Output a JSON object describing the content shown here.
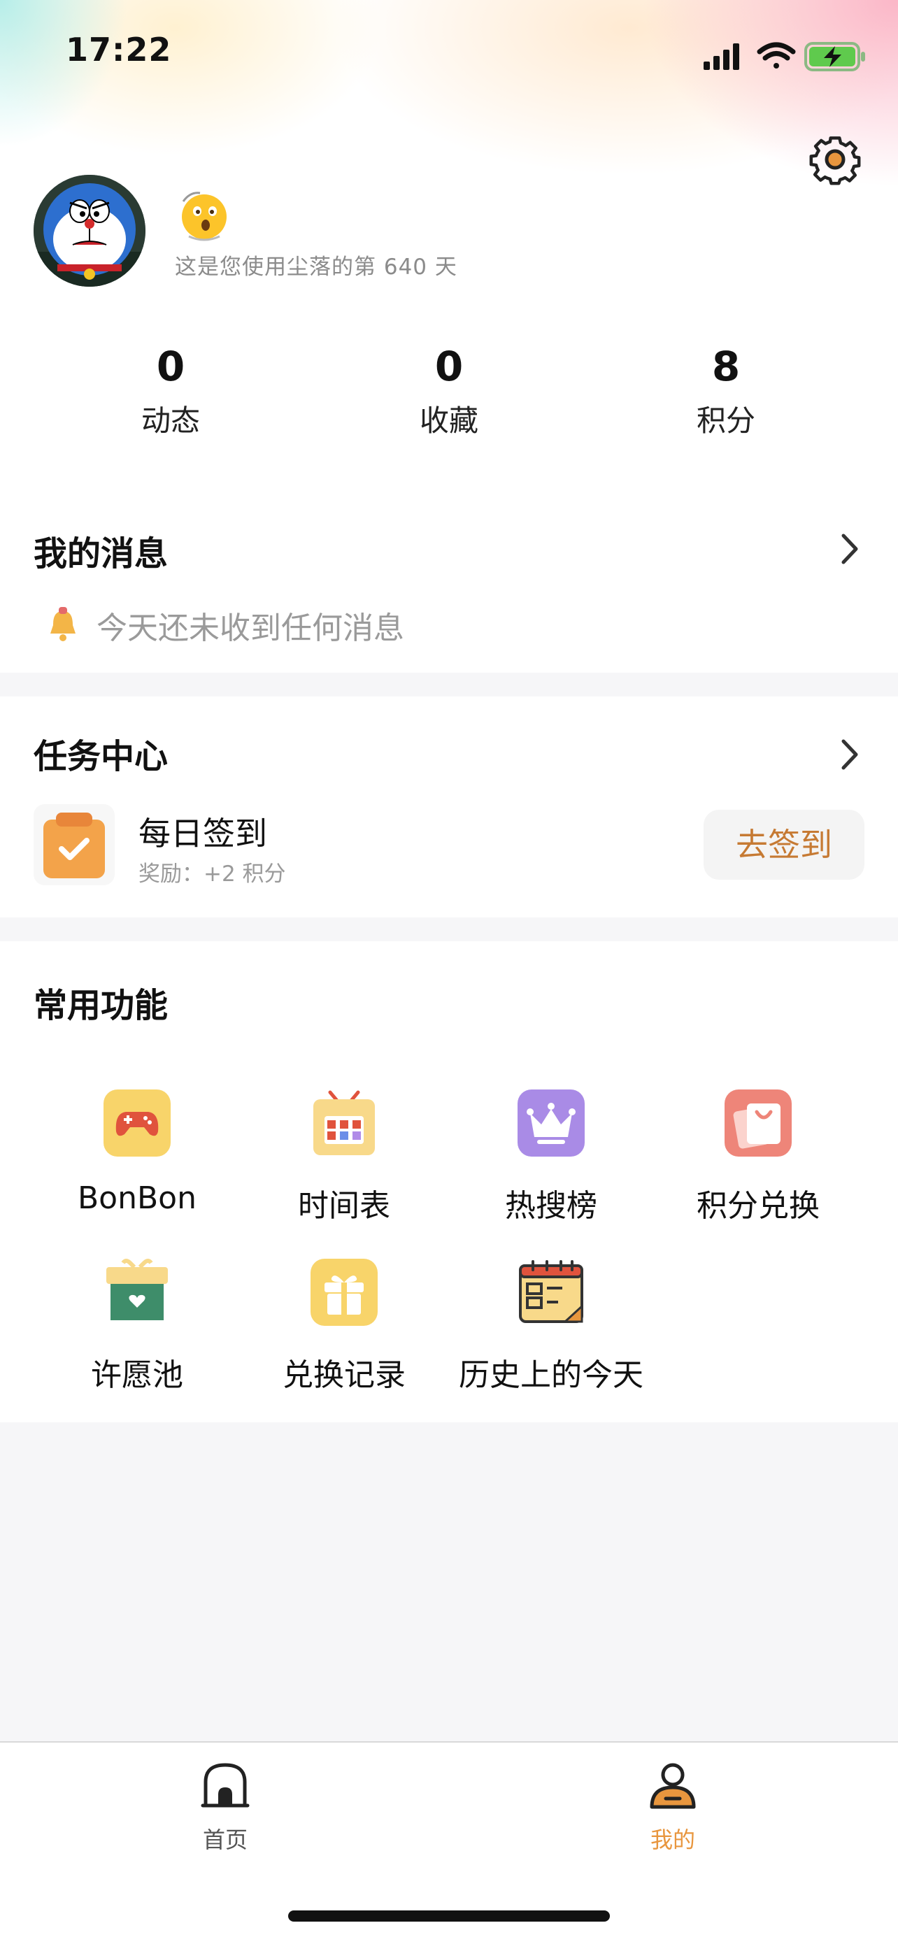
{
  "status_bar": {
    "time": "17:22"
  },
  "profile": {
    "avatar_alt": "Doraemon avatar",
    "days_text": "这是您使用尘落的第 640 天"
  },
  "stats": [
    {
      "value": "0",
      "label": "动态"
    },
    {
      "value": "0",
      "label": "收藏"
    },
    {
      "value": "8",
      "label": "积分"
    }
  ],
  "messages": {
    "title": "我的消息",
    "empty_text": "今天还未收到任何消息"
  },
  "tasks": {
    "title": "任务中心",
    "item_title": "每日签到",
    "item_reward": "奖励：+2 积分",
    "button_label": "去签到"
  },
  "features": {
    "title": "常用功能",
    "items": [
      {
        "label": "BonBon",
        "icon": "gamepad-icon"
      },
      {
        "label": "时间表",
        "icon": "calendar-tv-icon"
      },
      {
        "label": "热搜榜",
        "icon": "crown-icon"
      },
      {
        "label": "积分兑换",
        "icon": "shopping-bag-icon"
      },
      {
        "label": "许愿池",
        "icon": "wish-box-icon"
      },
      {
        "label": "兑换记录",
        "icon": "gift-icon"
      },
      {
        "label": "历史上的今天",
        "icon": "history-calendar-icon"
      }
    ]
  },
  "tabbar": {
    "items": [
      {
        "label": "首页",
        "icon": "home-icon",
        "active": false
      },
      {
        "label": "我的",
        "icon": "profile-icon",
        "active": true
      }
    ]
  },
  "colors": {
    "accent": "#e8963e",
    "signin_text": "#c67a33",
    "muted_text": "#9a9a9a"
  }
}
